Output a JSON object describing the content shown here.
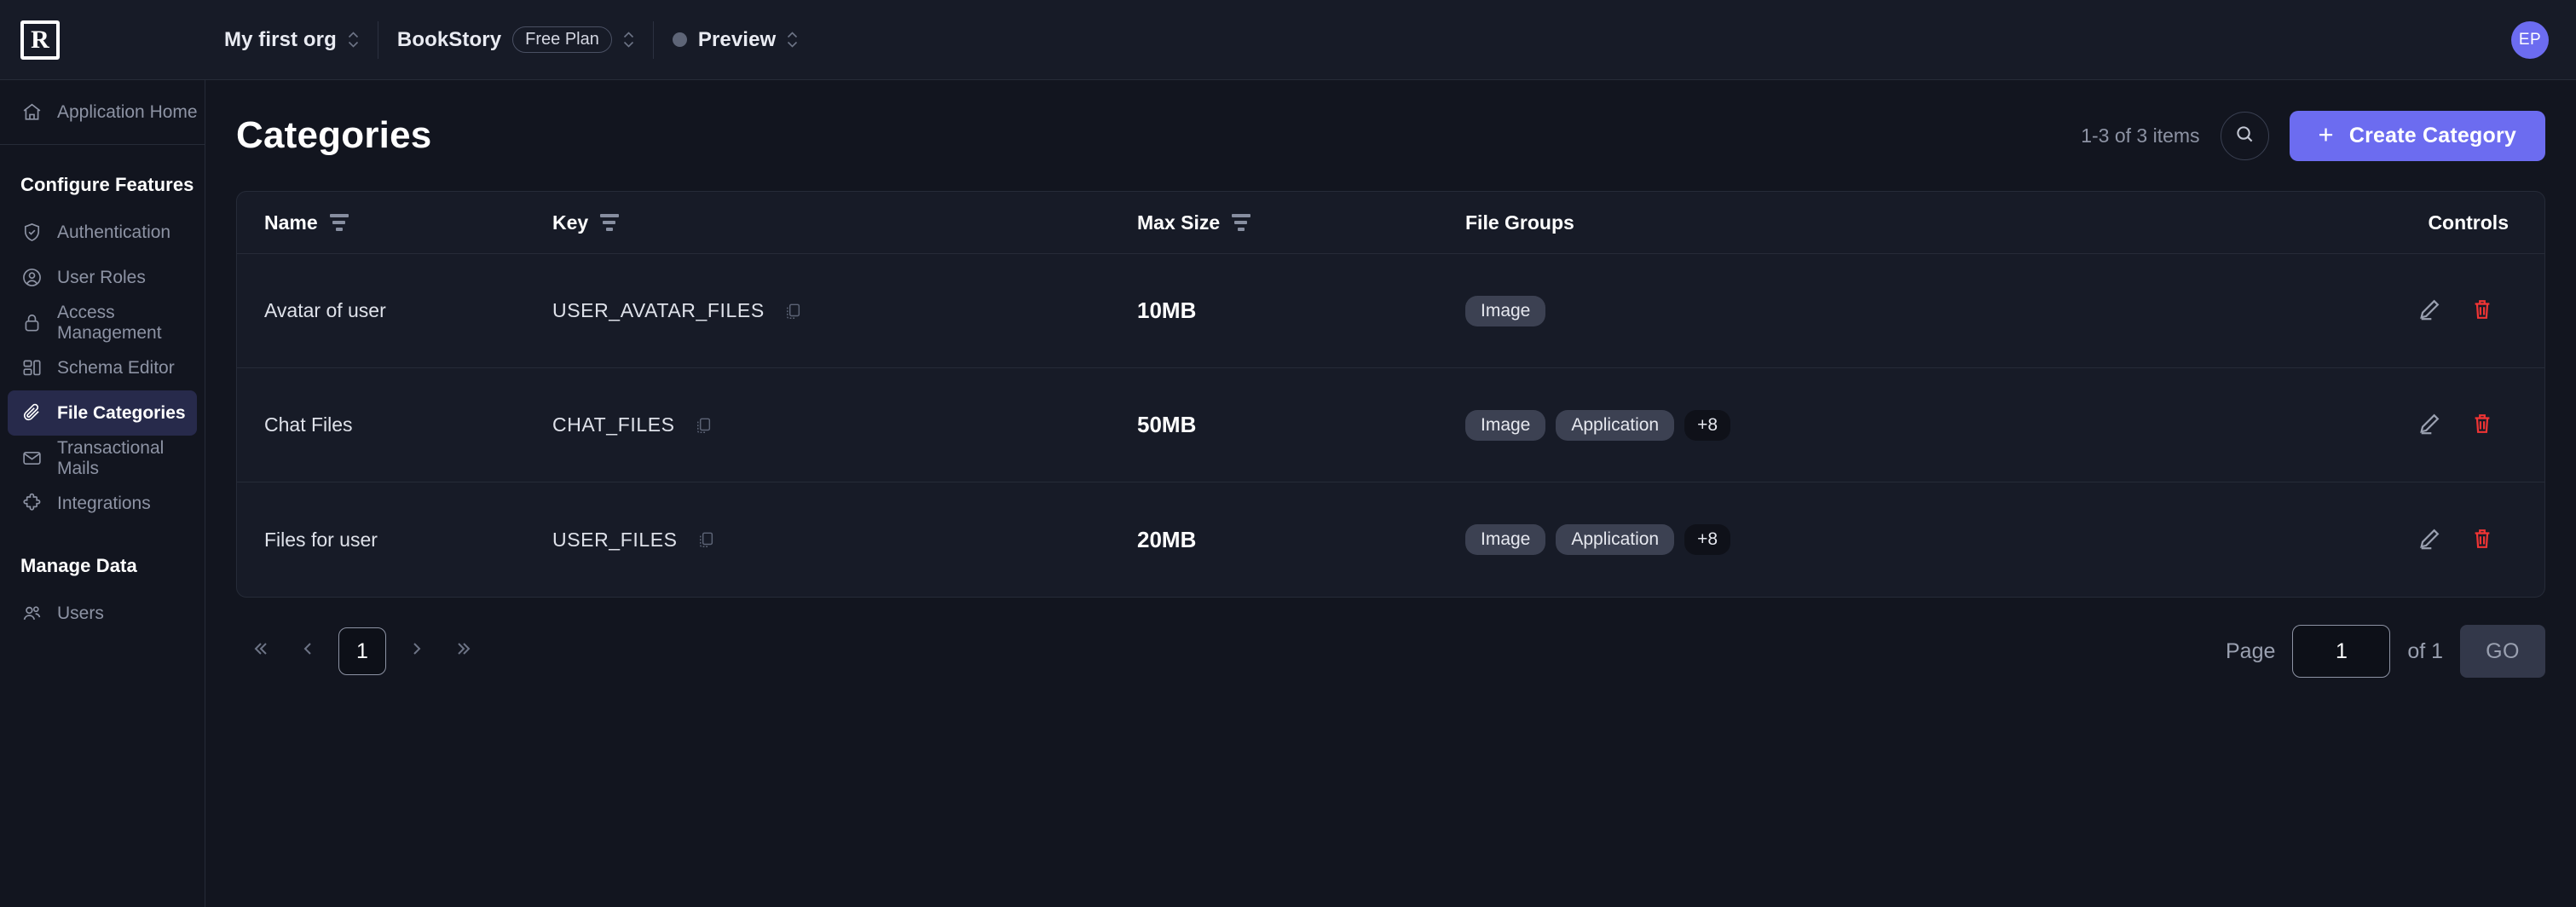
{
  "topbar": {
    "logo_letter": "R",
    "org_name": "My first org",
    "project_name": "BookStory",
    "plan_badge": "Free Plan",
    "env_name": "Preview",
    "avatar_initials": "EP"
  },
  "sidebar": {
    "home": {
      "label": "Application Home",
      "icon": "home-icon"
    },
    "sections": [
      {
        "title": "Configure Features",
        "items": [
          {
            "label": "Authentication",
            "icon": "shield-check-icon",
            "active": false
          },
          {
            "label": "User Roles",
            "icon": "user-circle-icon",
            "active": false
          },
          {
            "label": "Access Management",
            "icon": "lock-icon",
            "active": false
          },
          {
            "label": "Schema Editor",
            "icon": "schema-icon",
            "active": false
          },
          {
            "label": "File Categories",
            "icon": "paperclip-icon",
            "active": true
          },
          {
            "label": "Transactional Mails",
            "icon": "mail-icon",
            "active": false
          },
          {
            "label": "Integrations",
            "icon": "puzzle-icon",
            "active": false
          }
        ]
      },
      {
        "title": "Manage Data",
        "items": [
          {
            "label": "Users",
            "icon": "users-icon",
            "active": false
          }
        ]
      }
    ]
  },
  "page": {
    "title": "Categories",
    "item_count": "1-3 of 3 items",
    "search_icon": "search-icon",
    "create_button": "Create Category",
    "create_button_icon": "plus-icon"
  },
  "table": {
    "columns": [
      {
        "label": "Name",
        "filterable": true
      },
      {
        "label": "Key",
        "filterable": true
      },
      {
        "label": "Max Size",
        "filterable": true
      },
      {
        "label": "File Groups",
        "filterable": false
      },
      {
        "label": "Controls",
        "filterable": false
      }
    ],
    "rows": [
      {
        "name": "Avatar of user",
        "key": "USER_AVATAR_FILES",
        "max_size": "10MB",
        "groups": [
          "Image"
        ],
        "more": null
      },
      {
        "name": "Chat Files",
        "key": "CHAT_FILES",
        "max_size": "50MB",
        "groups": [
          "Image",
          "Application"
        ],
        "more": "+8"
      },
      {
        "name": "Files for user",
        "key": "USER_FILES",
        "max_size": "20MB",
        "groups": [
          "Image",
          "Application"
        ],
        "more": "+8"
      }
    ],
    "row_actions": {
      "edit": "edit-pencil-icon",
      "delete": "trash-icon",
      "copy": "copy-icon"
    }
  },
  "pagination": {
    "first_icon": "chevrons-left-icon",
    "prev_icon": "chevron-left-icon",
    "current_page": "1",
    "next_icon": "chevron-right-icon",
    "last_icon": "chevrons-right-icon",
    "page_label": "Page",
    "page_value": "1",
    "of_label": "of 1",
    "go_label": "GO"
  },
  "colors": {
    "accent": "#6c6cf0",
    "danger": "#ef3434",
    "active_nav_bg": "#272a4b",
    "panel": "#171b27",
    "background": "#12151f"
  }
}
